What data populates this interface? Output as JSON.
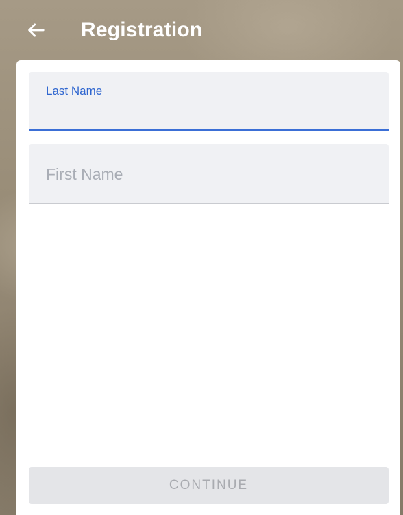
{
  "header": {
    "title": "Registration",
    "back_icon": "arrow-left-icon"
  },
  "form": {
    "last_name": {
      "label": "Last Name",
      "value": "",
      "state": "focused"
    },
    "first_name": {
      "placeholder": "First Name",
      "value": ""
    },
    "continue_label": "CONTINUE",
    "continue_enabled": false
  },
  "colors": {
    "accent": "#2f66cf",
    "focus_underline": "#3b6fd6",
    "field_background": "#f0f1f4",
    "disabled_button": "#e4e5e8",
    "disabled_text": "#a9abb0"
  }
}
